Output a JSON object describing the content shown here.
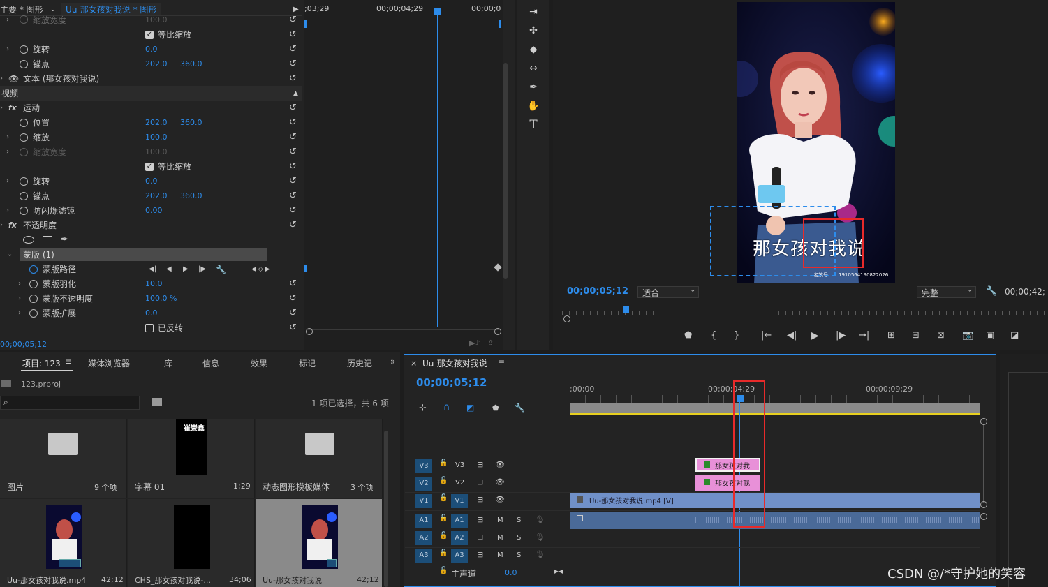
{
  "effect_controls": {
    "breadcrumb_left": "主要 * 图形",
    "breadcrumb_right": "Uu-那女孩对我说 * 图形",
    "top_rows": [
      {
        "label": "缩放宽度",
        "v1": "100.0",
        "disabled": true
      },
      {
        "label": "等比缩放",
        "checkbox": true
      },
      {
        "label": "旋转",
        "v1": "0.0"
      },
      {
        "label": "锚点",
        "v1": "202.0",
        "v2": "360.0"
      }
    ],
    "text_layer": "文本 (那女孩对我说)",
    "video_header": "视频",
    "motion": "运动",
    "motion_rows": [
      {
        "label": "位置",
        "v1": "202.0",
        "v2": "360.0"
      },
      {
        "label": "缩放",
        "v1": "100.0"
      },
      {
        "label": "缩放宽度",
        "v1": "100.0",
        "disabled": true
      },
      {
        "label": "等比缩放",
        "checkbox": true
      },
      {
        "label": "旋转",
        "v1": "0.0"
      },
      {
        "label": "锚点",
        "v1": "202.0",
        "v2": "360.0"
      },
      {
        "label": "防闪烁滤镜",
        "v1": "0.00"
      }
    ],
    "opacity": "不透明度",
    "mask": "蒙版 (1)",
    "mask_path": "蒙版路径",
    "mask_rows": [
      {
        "label": "蒙版羽化",
        "v1": "10.0"
      },
      {
        "label": "蒙版不透明度",
        "v1": "100.0 %"
      },
      {
        "label": "蒙版扩展",
        "v1": "0.0"
      }
    ],
    "inverted": "已反转",
    "timecode": "00;00;05;12",
    "ruler": [
      ";03;29",
      "00;00;04;29",
      "00;00;0"
    ]
  },
  "program": {
    "timecode": "00;00;05;12",
    "fit": "适合",
    "quality": "完整",
    "duration": "00;00;42;",
    "caption": "那女孩对我说",
    "watermark_text": "1910564190822026",
    "watermark_prefix": "名某号"
  },
  "project": {
    "tabs": [
      "项目: 123",
      "媒体浏览器",
      "库",
      "信息",
      "效果",
      "标记",
      "历史记"
    ],
    "file": "123.prproj",
    "status": "1 项已选择，共 6 项",
    "items": [
      {
        "name": "图片",
        "meta": "9 个项"
      },
      {
        "name": "字幕 01",
        "meta": "1;29",
        "thumb_text": "崔崇鑫"
      },
      {
        "name": "动态图形模板媒体",
        "meta": "3 个项"
      },
      {
        "name": "Uu-那女孩对我说.mp4",
        "meta": "42;12"
      },
      {
        "name": "CHS_那女孩对我说-...",
        "meta": "34;06"
      },
      {
        "name": "Uu-那女孩对我说",
        "meta": "42;12"
      }
    ]
  },
  "timeline": {
    "title": "Uu-那女孩对我说",
    "timecode": "00;00;05;12",
    "ruler": [
      ";00;00",
      "00;00;04;29",
      "00;00;09;29"
    ],
    "tracks": [
      {
        "id": "V3",
        "src": "V3"
      },
      {
        "id": "V2",
        "src": "V2"
      },
      {
        "id": "V1",
        "src": "V1"
      },
      {
        "id": "A1",
        "src": "A1"
      },
      {
        "id": "A2",
        "src": "A2"
      },
      {
        "id": "A3",
        "src": "A3"
      }
    ],
    "clip_v3": "那女孩对我",
    "clip_v2": "那女孩对我",
    "clip_v1": "Uu-那女孩对我说.mp4 [V]",
    "master": "主声道",
    "master_val": "0.0",
    "m": "M",
    "s": "S"
  },
  "watermark": "CSDN @/*守护她的笑容"
}
